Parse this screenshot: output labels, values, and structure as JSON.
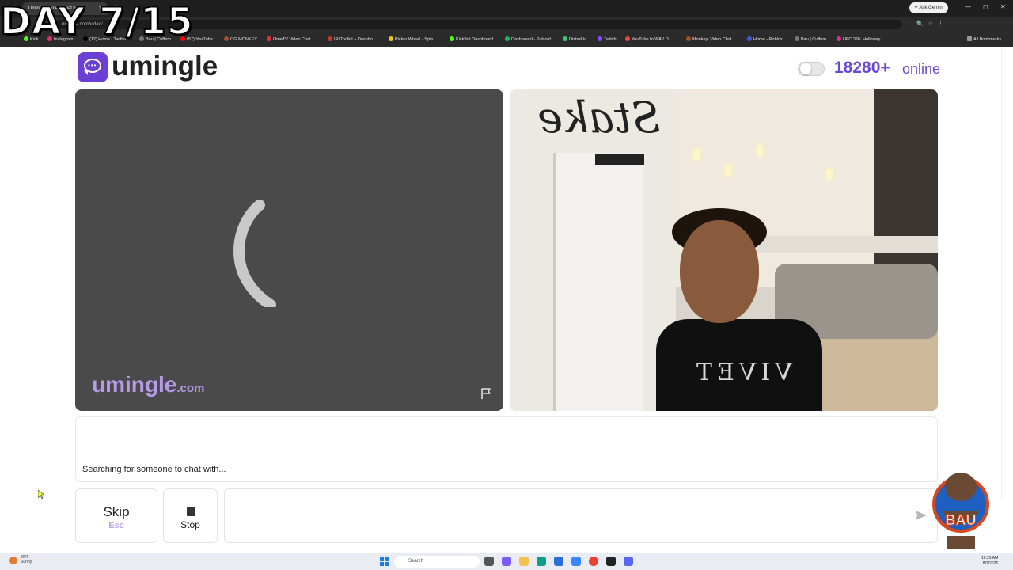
{
  "overlay": {
    "day_text": "DAY 7/15"
  },
  "browser": {
    "tab_title": "Umingle: Video Chat with S...",
    "url": "umingle.com/video/",
    "ask_gemini": "Ask Gemini",
    "bookmarks": [
      "Kick",
      "Instagram",
      "(12) Home / Twitter",
      "Bau | Cuffem",
      "(57) YouTube",
      "OG MONKEY",
      "OmeTV Video Chat...",
      "IRLToolkit + Dashbo...",
      "Picker Wheel - Spin...",
      "KickBot Dashboard",
      "Dashboard - Pulsoid",
      "DistroKid",
      "Twitch",
      "YouTube to WAV D...",
      "Monkey: Video Chat...",
      "Home - Roblox",
      "Bau | Cuffem",
      "UFC 326: Holloway..."
    ],
    "all_bookmarks": "All Bookmarks"
  },
  "header": {
    "logo_text": "umingle",
    "online_count": "18280+",
    "online_label": "online"
  },
  "video": {
    "watermark_main": "umingle",
    "watermark_suffix": ".com",
    "remote_shirt_text": "VIVET"
  },
  "chat": {
    "status": "Searching for someone to chat with...",
    "input_value": "",
    "skip_label": "Skip",
    "skip_key": "Esc",
    "stop_label": "Stop"
  },
  "taskbar": {
    "weather_temp": "80°F",
    "weather_desc": "Sunny",
    "search_placeholder": "Search",
    "time": "10:25 AM",
    "date": "8/2/2026"
  },
  "colors": {
    "brand": "#6b3fd3",
    "online": "#6a47d6",
    "watermark": "#b59be6"
  }
}
